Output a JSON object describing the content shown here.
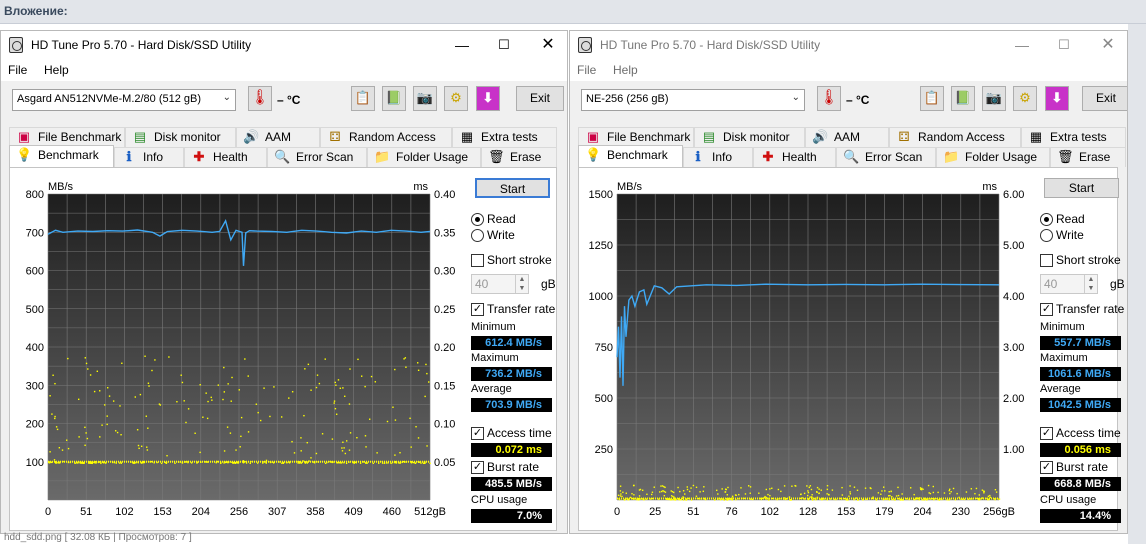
{
  "forum": {
    "header": "Вложение:",
    "footer": "hdd_sdd.png [ 32.08 КБ | Просмотров: 7 ]"
  },
  "windows": [
    {
      "title": "HD Tune Pro 5.70 - Hard Disk/SSD Utility",
      "menu": [
        "File",
        "Help"
      ],
      "drive": "Asgard AN512NVMe-M.2/80 (512 gB)",
      "temp": "– °C",
      "exit": "Exit",
      "tabs_row1": [
        "File Benchmark",
        "Disk monitor",
        "AAM",
        "Random Access",
        "Extra tests"
      ],
      "tabs_row2": [
        "Benchmark",
        "Info",
        "Health",
        "Error Scan",
        "Folder Usage",
        "Erase"
      ],
      "start": "Start",
      "read": "Read",
      "write": "Write",
      "short_stroke": "Short stroke",
      "stroke_value": "40",
      "stroke_unit": "gB",
      "transfer_rate": "Transfer rate",
      "minimum_label": "Minimum",
      "minimum": "612.4 MB/s",
      "maximum_label": "Maximum",
      "maximum": "736.2 MB/s",
      "average_label": "Average",
      "average": "703.9 MB/s",
      "access_time_label": "Access time",
      "access_time": "0.072 ms",
      "burst_rate_label": "Burst rate",
      "burst_rate": "485.5 MB/s",
      "cpu_label": "CPU usage",
      "cpu": "7.0%",
      "chart_data": {
        "type": "line",
        "ylabel": "MB/s",
        "y2label": "ms",
        "ylim": [
          0,
          800
        ],
        "y_ticks": [
          "800",
          "700",
          "600",
          "500",
          "400",
          "300",
          "200",
          "100"
        ],
        "y2lim": [
          0,
          0.4
        ],
        "y2_ticks": [
          "0.40",
          "0.35",
          "0.30",
          "0.25",
          "0.20",
          "0.15",
          "0.10",
          "0.05"
        ],
        "x_ticks": [
          "0",
          "51",
          "102",
          "153",
          "204",
          "256",
          "307",
          "358",
          "409",
          "460",
          "512gB"
        ],
        "xlim": [
          0,
          512
        ],
        "series": [
          {
            "values_x": [
              0,
              10,
              20,
              40,
              60,
              80,
              100,
              120,
              140,
              150,
              160,
              180,
              200,
              220,
              230,
              238,
              245,
              252,
              260,
              262,
              265,
              270,
              280,
              300,
              320,
              340,
              360,
              380,
              400,
              420,
              440,
              460,
              480,
              500,
              512
            ],
            "values_y": [
              695,
              705,
              700,
              703,
              702,
              704,
              703,
              706,
              700,
              690,
              702,
              705,
              703,
              700,
              702,
              730,
              680,
              705,
              700,
              612,
              698,
              704,
              703,
              702,
              700,
              705,
              703,
              700,
              698,
              703,
              700,
              705,
              703,
              700,
              702
            ]
          }
        ],
        "access_scatter_band_ms": [
          0.05,
          0.19
        ],
        "colors": {
          "line": "#3fa9f5",
          "scatter": "#ffff00",
          "bg": "#3c3c3c",
          "grid": "#7a7a7a"
        }
      }
    },
    {
      "title": "HD Tune Pro 5.70 - Hard Disk/SSD Utility",
      "menu": [
        "File",
        "Help"
      ],
      "drive": "NE-256 (256 gB)",
      "temp": "– °C",
      "exit": "Exit",
      "tabs_row1": [
        "File Benchmark",
        "Disk monitor",
        "AAM",
        "Random Access",
        "Extra tests"
      ],
      "tabs_row2": [
        "Benchmark",
        "Info",
        "Health",
        "Error Scan",
        "Folder Usage",
        "Erase"
      ],
      "start": "Start",
      "read": "Read",
      "write": "Write",
      "short_stroke": "Short stroke",
      "stroke_value": "40",
      "stroke_unit": "gB",
      "transfer_rate": "Transfer rate",
      "minimum_label": "Minimum",
      "minimum": "557.7 MB/s",
      "maximum_label": "Maximum",
      "maximum": "1061.6 MB/s",
      "average_label": "Average",
      "average": "1042.5 MB/s",
      "access_time_label": "Access time",
      "access_time": "0.056 ms",
      "burst_rate_label": "Burst rate",
      "burst_rate": "668.8 MB/s",
      "cpu_label": "CPU usage",
      "cpu": "14.4%",
      "chart_data": {
        "type": "line",
        "ylabel": "MB/s",
        "y2label": "ms",
        "ylim": [
          0,
          1500
        ],
        "y_ticks": [
          "1500",
          "1250",
          "1000",
          "750",
          "500",
          "250"
        ],
        "y2lim": [
          0,
          6
        ],
        "y2_ticks": [
          "6.00",
          "5.00",
          "4.00",
          "3.00",
          "2.00",
          "1.00"
        ],
        "x_ticks": [
          "0",
          "25",
          "51",
          "76",
          "102",
          "128",
          "153",
          "179",
          "204",
          "230",
          "256gB"
        ],
        "xlim": [
          0,
          256
        ],
        "series": [
          {
            "values_x": [
              0,
              1,
              2,
              3,
              4,
              5,
              6,
              8,
              10,
              12,
              15,
              18,
              20,
              25,
              30,
              35,
              40,
              50,
              60,
              80,
              100,
              128,
              153,
              179,
              204,
              230,
              256
            ],
            "values_y": [
              700,
              850,
              600,
              900,
              560,
              950,
              800,
              980,
              1000,
              950,
              1020,
              1030,
              960,
              1050,
              1040,
              1010,
              1045,
              1050,
              1055,
              1052,
              1058,
              1055,
              1057,
              1055,
              1058,
              1056,
              1055
            ]
          }
        ],
        "access_scatter_band_ms": [
          0.03,
          0.3
        ],
        "colors": {
          "line": "#3fa9f5",
          "scatter": "#ffff00",
          "bg": "#3c3c3c",
          "grid": "#7a7a7a"
        }
      }
    }
  ]
}
